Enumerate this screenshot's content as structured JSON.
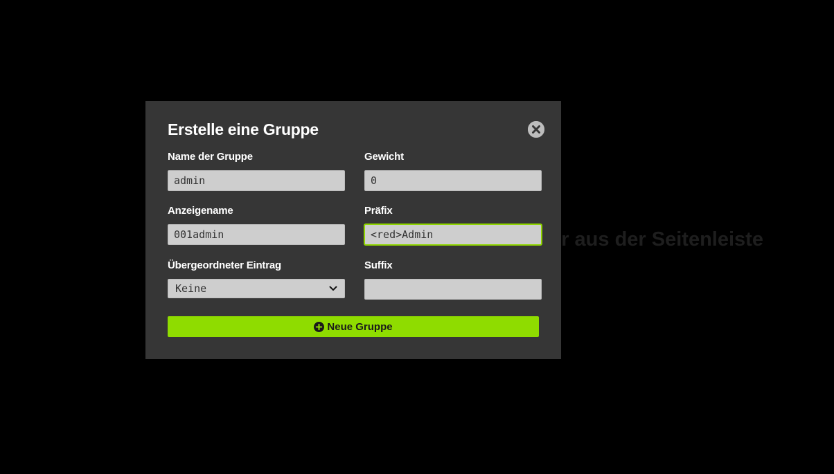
{
  "background": {
    "hint_text": "Wähle eine Gruppe oder einen Benutzer aus der Seitenleiste"
  },
  "modal": {
    "title": "Erstelle eine Gruppe",
    "close_icon": "close-circle-icon",
    "fields": {
      "group_name": {
        "label": "Name der Gruppe",
        "value": "admin"
      },
      "weight": {
        "label": "Gewicht",
        "value": "0"
      },
      "display_name": {
        "label": "Anzeigename",
        "value": "001admin"
      },
      "prefix": {
        "label": "Präfix",
        "value": "<red>Admin"
      },
      "parent": {
        "label": "Übergeordneter Eintrag",
        "selected": "Keine"
      },
      "suffix": {
        "label": "Suffix",
        "value": ""
      }
    },
    "submit": {
      "label": "Neue Gruppe",
      "icon": "plus-circle-icon"
    }
  },
  "colors": {
    "backdrop": "#000000",
    "modal_bg": "#363636",
    "input_bg": "#cecece",
    "accent": "#8fdc00",
    "focus_border": "#8fd500"
  }
}
